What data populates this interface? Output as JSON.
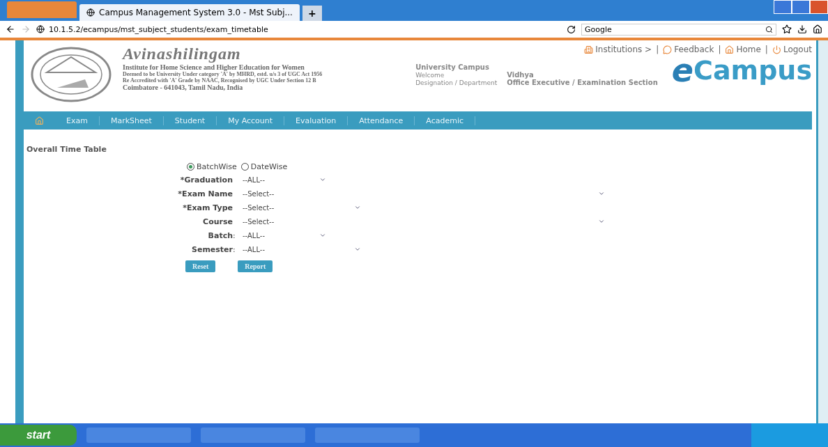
{
  "browser": {
    "tab_title": "Campus Management System 3.0 - Mst Subj...",
    "new_tab": "+",
    "address": "10.1.5.2/ecampus/mst_subject_students/exam_timetable",
    "search_engine": "Google"
  },
  "header": {
    "logo_title": "Avinashilingam",
    "subtitle": "Institute for Home Science and Higher Education for Women",
    "lines": [
      "Deemed to be University Under category 'A' by MHRD, estd. u/s 3 of UGC Act 1956",
      "Re Accredited with 'A' Grade by NAAC, Recognised by UGC Under Section 12 B"
    ],
    "address": "Coimbatore - 641043, Tamil Nadu, India",
    "links": [
      {
        "label": "Institutions >",
        "kind": "institution"
      },
      {
        "separator": "|",
        "label": "Feedback",
        "kind": "feedback"
      },
      {
        "separator": "|",
        "label": "Home",
        "kind": "home"
      },
      {
        "separator": "|",
        "label": "Logout",
        "kind": "logout"
      }
    ],
    "campus": "University Campus",
    "welcome_label": "Welcome",
    "user": "Vidhya",
    "designation_label": "Designation / Department",
    "designation": "Office Executive / Examination Section",
    "brand_e": "e",
    "brand": "Campus"
  },
  "nav": [
    {
      "label": "Exam"
    },
    {
      "label": "MarkSheet"
    },
    {
      "label": "Student"
    },
    {
      "label": "My Account"
    },
    {
      "label": "Evaluation"
    },
    {
      "label": "Attendance"
    },
    {
      "label": "Academic"
    }
  ],
  "page_title": "Overall Time Table",
  "modes": [
    {
      "label": "BatchWise",
      "selected": true
    },
    {
      "label": "DateWise",
      "selected": false
    }
  ],
  "fields": [
    {
      "label": "*Graduation",
      "value": "--ALL--"
    },
    {
      "label": "*Exam Name",
      "value": "--Select--"
    },
    {
      "label": "*Exam Type",
      "value": "--Select--"
    },
    {
      "label": "Course",
      "value": "--Select--"
    },
    {
      "label": "Batch",
      "colon": ":",
      "value": "--ALL--"
    },
    {
      "label": "Semester",
      "colon": ":",
      "value": "--ALL--"
    }
  ],
  "buttons": [
    "Reset",
    "Report"
  ],
  "taskbar": {
    "start": "start"
  }
}
